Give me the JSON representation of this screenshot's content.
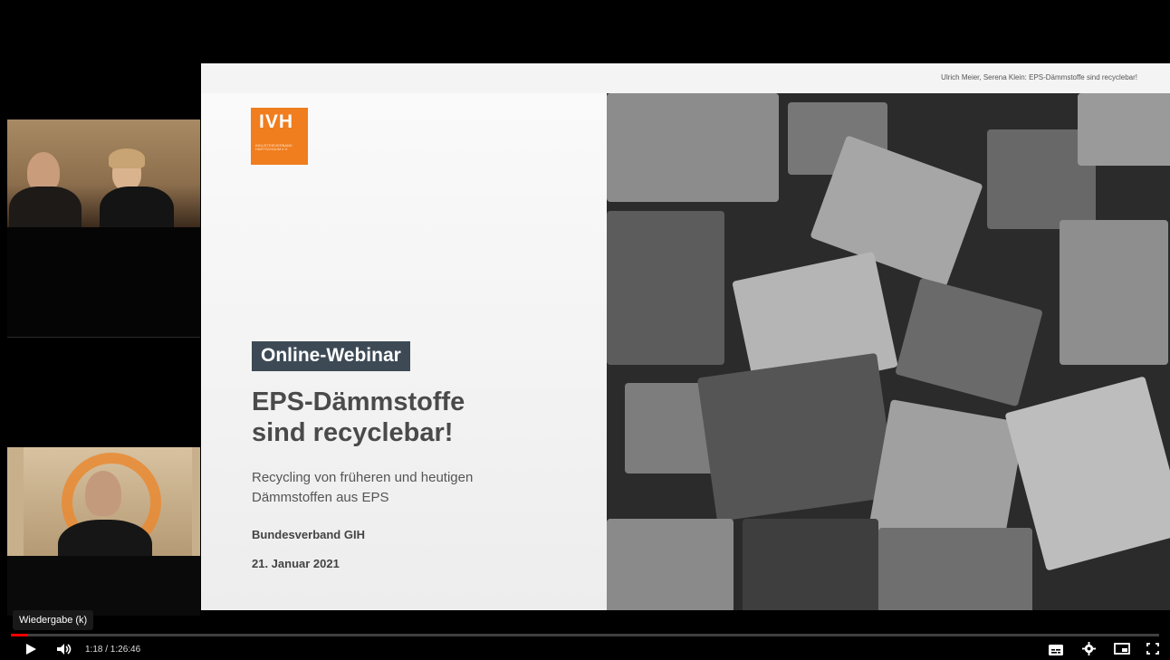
{
  "slide": {
    "header": "Ulrich Meier, Serena Klein: EPS-Dämmstoffe sind recyclebar!",
    "logo": "IVH",
    "logo_tagline": "INDUSTRIEVERBAND HARTSCHAUM e.V.",
    "badge": "Online-Webinar",
    "title_line1": "EPS-Dämmstoffe",
    "title_line2": "sind recyclebar!",
    "subtitle_line1": "Recycling von früheren und heutigen",
    "subtitle_line2": "Dämmstoffen aus EPS",
    "organizer": "Bundesverband GIH",
    "date": "21. Januar 2021"
  },
  "player": {
    "tooltip": "Wiedergabe (k)",
    "time": "1:18 / 1:26:46",
    "progress_fraction": 0.015,
    "icons": [
      "play-icon",
      "volume-icon",
      "subtitles-icon",
      "settings-icon",
      "miniplayer-icon",
      "fullscreen-icon"
    ]
  },
  "colors": {
    "brand_orange": "#f07d1e",
    "badge_bg": "#3d4a56",
    "progress": "#ff0000"
  }
}
